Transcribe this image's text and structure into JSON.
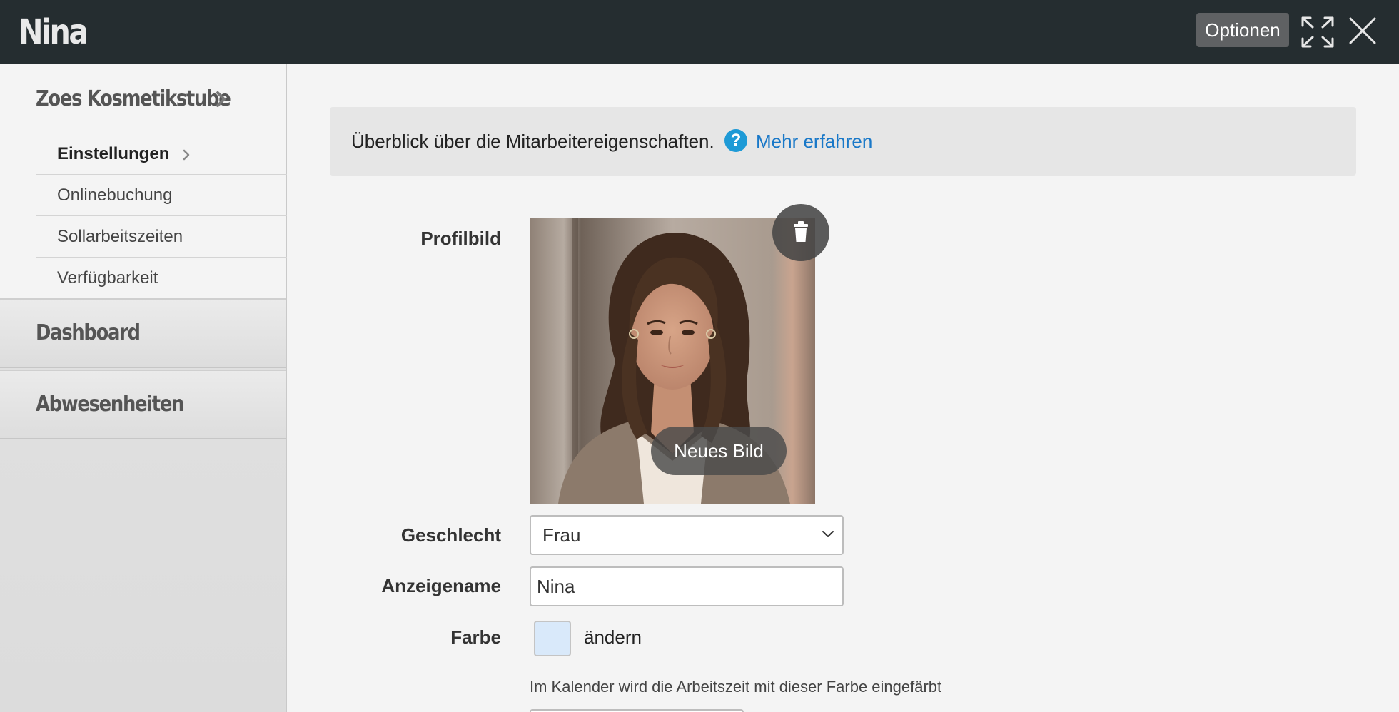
{
  "header": {
    "title": "Nina",
    "options_label": "Optionen",
    "expand_icon": "expand-icon",
    "close_icon": "close-icon"
  },
  "sidebar": {
    "company": "Zoes Kosmetikstube",
    "items": [
      {
        "label": "Einstellungen",
        "active": true
      },
      {
        "label": "Onlinebuchung"
      },
      {
        "label": "Sollarbeitszeiten"
      },
      {
        "label": "Verfügbarkeit"
      }
    ],
    "sections": [
      {
        "label": "Dashboard"
      },
      {
        "label": "Abwesenheiten"
      }
    ]
  },
  "info": {
    "text": "Überblick über die Mitarbeitereigenschaften.",
    "help_icon": "question-icon",
    "link": "Mehr erfahren"
  },
  "form": {
    "profile_label": "Profilbild",
    "new_photo": "Neues Bild",
    "delete_icon": "trash-icon",
    "gender_label": "Geschlecht",
    "gender_value": "Frau",
    "name_label": "Anzeigename",
    "name_value": "Nina",
    "color_label": "Farbe",
    "color_value": "#d9e9fa",
    "color_change": "ändern",
    "color_help": "Im Kalender wird die Arbeitszeit mit dieser Farbe eingefärbt"
  },
  "colors": {
    "header_bg": "#252d30",
    "link": "#1978c8",
    "help_icon": "#1e9ad6"
  }
}
